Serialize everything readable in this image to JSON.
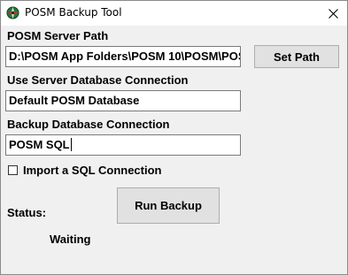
{
  "window": {
    "title": "POSM Backup Tool",
    "icon": "posm-icon",
    "close_icon": "close-icon"
  },
  "server_path": {
    "label": "POSM Server Path",
    "value": "D:\\POSM App Folders\\POSM 10\\POSM\\POSM",
    "button_label": "Set Path"
  },
  "server_db": {
    "label": "Use Server Database Connection",
    "value": "Default POSM Database"
  },
  "backup_db": {
    "label": "Backup Database Connection",
    "value": "POSM SQL"
  },
  "import_sql": {
    "label": "Import a SQL Connection",
    "checked": false
  },
  "run_button_label": "Run Backup",
  "status": {
    "label": "Status:",
    "value": "Waiting"
  }
}
